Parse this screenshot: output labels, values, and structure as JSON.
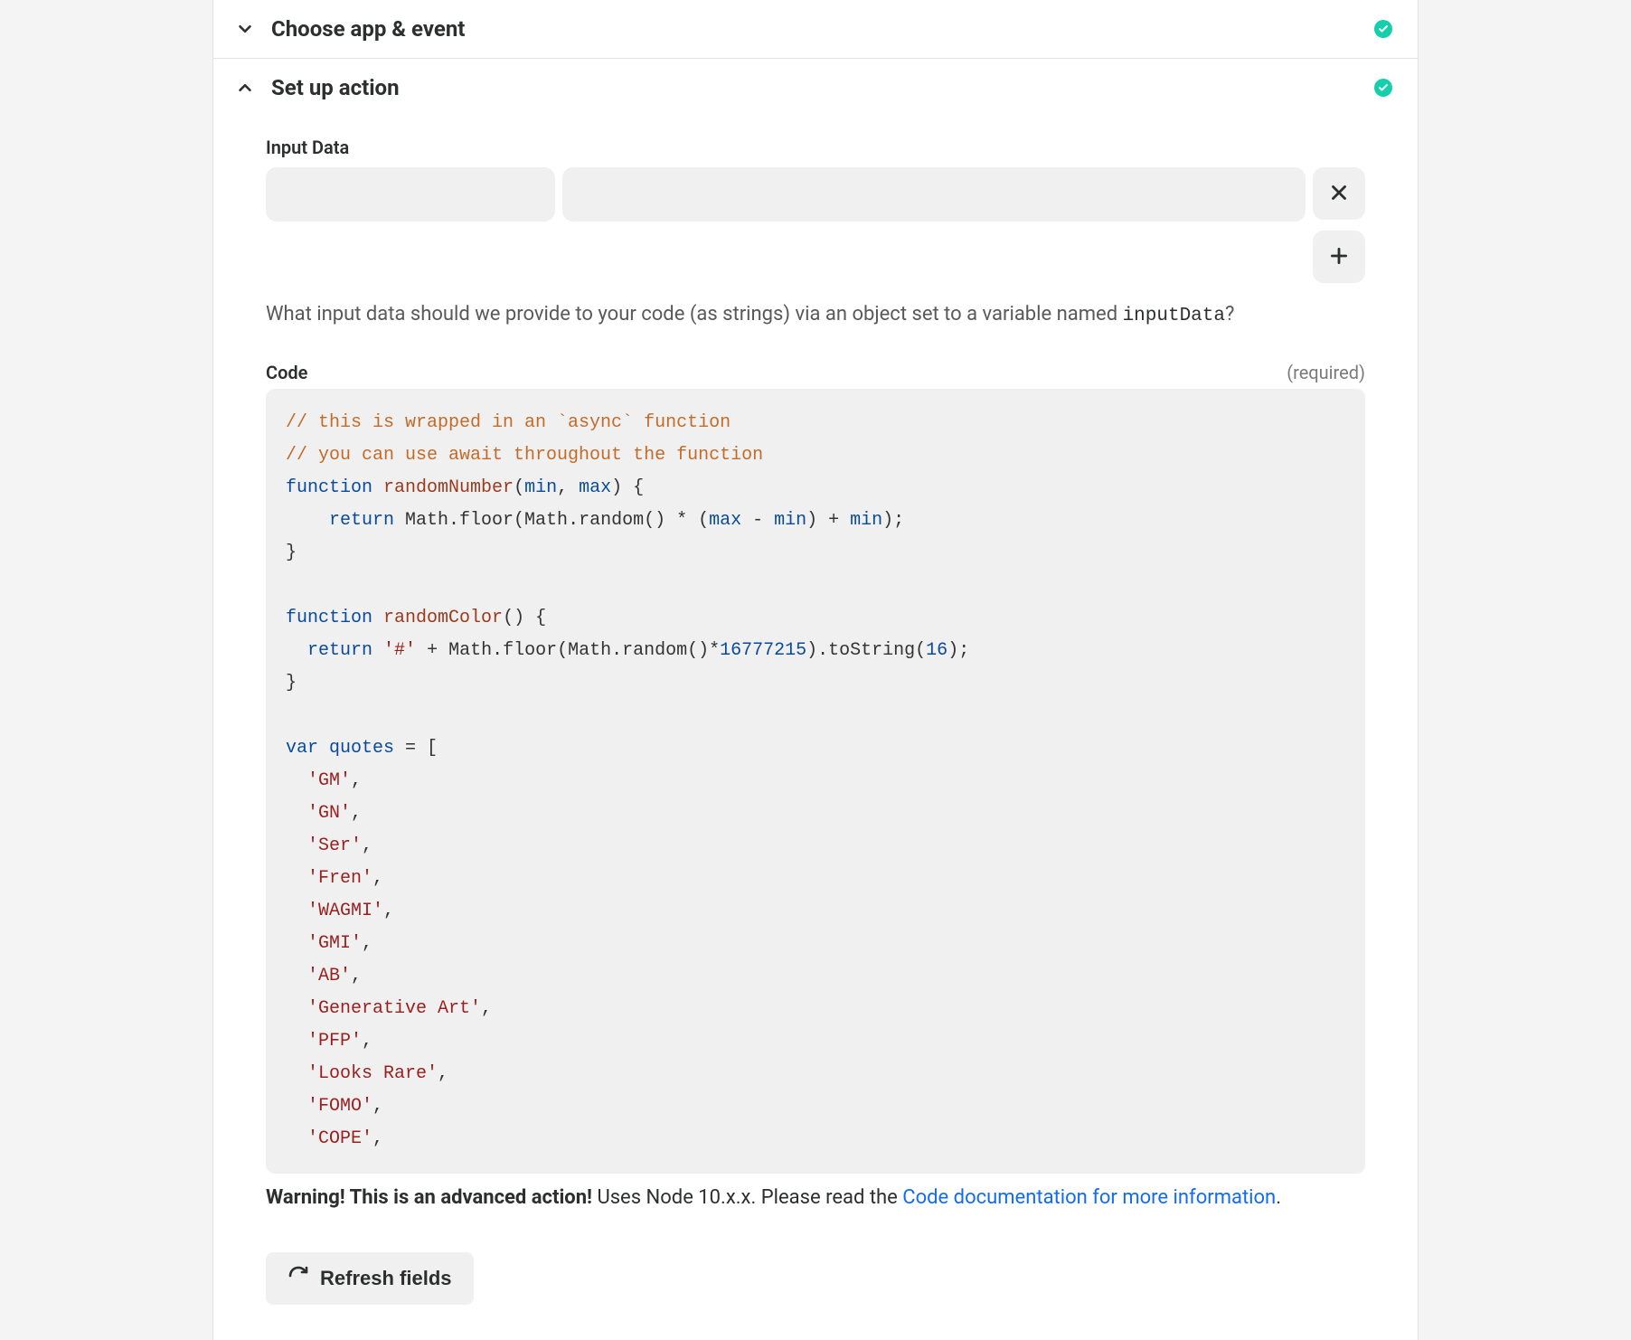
{
  "sections": {
    "choose": {
      "title": "Choose app & event",
      "complete": true
    },
    "setup": {
      "title": "Set up action",
      "complete": true
    }
  },
  "inputData": {
    "label": "Input Data",
    "help_prefix": "What input data should we provide to your code (as strings) via an object set to a variable named ",
    "help_var": "inputData",
    "help_suffix": "?"
  },
  "code": {
    "label": "Code",
    "required_label": "(required)",
    "tokens": [
      {
        "t": "comment",
        "v": "// this is wrapped in an `async` function"
      },
      {
        "t": "nl"
      },
      {
        "t": "comment",
        "v": "// you can use await throughout the function"
      },
      {
        "t": "nl"
      },
      {
        "t": "kw",
        "v": "function"
      },
      {
        "t": "sp"
      },
      {
        "t": "fn",
        "v": "randomNumber"
      },
      {
        "t": "punc",
        "v": "("
      },
      {
        "t": "param",
        "v": "min"
      },
      {
        "t": "punc",
        "v": ", "
      },
      {
        "t": "param",
        "v": "max"
      },
      {
        "t": "punc",
        "v": ") {"
      },
      {
        "t": "nl"
      },
      {
        "t": "punc",
        "v": "    "
      },
      {
        "t": "kw",
        "v": "return"
      },
      {
        "t": "punc",
        "v": " Math.floor(Math.random() * ("
      },
      {
        "t": "param",
        "v": "max"
      },
      {
        "t": "punc",
        "v": " - "
      },
      {
        "t": "param",
        "v": "min"
      },
      {
        "t": "punc",
        "v": ") + "
      },
      {
        "t": "param",
        "v": "min"
      },
      {
        "t": "punc",
        "v": ");"
      },
      {
        "t": "nl"
      },
      {
        "t": "punc",
        "v": "}"
      },
      {
        "t": "nl"
      },
      {
        "t": "nl"
      },
      {
        "t": "kw",
        "v": "function"
      },
      {
        "t": "sp"
      },
      {
        "t": "fn",
        "v": "randomColor"
      },
      {
        "t": "punc",
        "v": "() {"
      },
      {
        "t": "nl"
      },
      {
        "t": "punc",
        "v": "  "
      },
      {
        "t": "kw",
        "v": "return"
      },
      {
        "t": "punc",
        "v": " "
      },
      {
        "t": "str",
        "v": "'#'"
      },
      {
        "t": "punc",
        "v": " + Math.floor(Math.random()*"
      },
      {
        "t": "num",
        "v": "16777215"
      },
      {
        "t": "punc",
        "v": ").toString("
      },
      {
        "t": "num",
        "v": "16"
      },
      {
        "t": "punc",
        "v": ");"
      },
      {
        "t": "nl"
      },
      {
        "t": "punc",
        "v": "}"
      },
      {
        "t": "nl"
      },
      {
        "t": "nl"
      },
      {
        "t": "kw",
        "v": "var"
      },
      {
        "t": "sp"
      },
      {
        "t": "param",
        "v": "quotes"
      },
      {
        "t": "punc",
        "v": " = ["
      },
      {
        "t": "nl"
      },
      {
        "t": "punc",
        "v": "  "
      },
      {
        "t": "str",
        "v": "'GM'"
      },
      {
        "t": "punc",
        "v": ","
      },
      {
        "t": "nl"
      },
      {
        "t": "punc",
        "v": "  "
      },
      {
        "t": "str",
        "v": "'GN'"
      },
      {
        "t": "punc",
        "v": ","
      },
      {
        "t": "nl"
      },
      {
        "t": "punc",
        "v": "  "
      },
      {
        "t": "str",
        "v": "'Ser'"
      },
      {
        "t": "punc",
        "v": ","
      },
      {
        "t": "nl"
      },
      {
        "t": "punc",
        "v": "  "
      },
      {
        "t": "str",
        "v": "'Fren'"
      },
      {
        "t": "punc",
        "v": ","
      },
      {
        "t": "nl"
      },
      {
        "t": "punc",
        "v": "  "
      },
      {
        "t": "str",
        "v": "'WAGMI'"
      },
      {
        "t": "punc",
        "v": ","
      },
      {
        "t": "nl"
      },
      {
        "t": "punc",
        "v": "  "
      },
      {
        "t": "str",
        "v": "'GMI'"
      },
      {
        "t": "punc",
        "v": ","
      },
      {
        "t": "nl"
      },
      {
        "t": "punc",
        "v": "  "
      },
      {
        "t": "str",
        "v": "'AB'"
      },
      {
        "t": "punc",
        "v": ","
      },
      {
        "t": "nl"
      },
      {
        "t": "punc",
        "v": "  "
      },
      {
        "t": "str",
        "v": "'Generative Art'"
      },
      {
        "t": "punc",
        "v": ","
      },
      {
        "t": "nl"
      },
      {
        "t": "punc",
        "v": "  "
      },
      {
        "t": "str",
        "v": "'PFP'"
      },
      {
        "t": "punc",
        "v": ","
      },
      {
        "t": "nl"
      },
      {
        "t": "punc",
        "v": "  "
      },
      {
        "t": "str",
        "v": "'Looks Rare'"
      },
      {
        "t": "punc",
        "v": ","
      },
      {
        "t": "nl"
      },
      {
        "t": "punc",
        "v": "  "
      },
      {
        "t": "str",
        "v": "'FOMO'"
      },
      {
        "t": "punc",
        "v": ","
      },
      {
        "t": "nl"
      },
      {
        "t": "punc",
        "v": "  "
      },
      {
        "t": "str",
        "v": "'COPE'"
      },
      {
        "t": "punc",
        "v": ","
      }
    ]
  },
  "warning": {
    "bold": "Warning! This is an advanced action!",
    "middle": " Uses Node 10.x.x. Please read the ",
    "link": "Code documentation for more information",
    "tail": "."
  },
  "refresh_label": "Refresh fields"
}
